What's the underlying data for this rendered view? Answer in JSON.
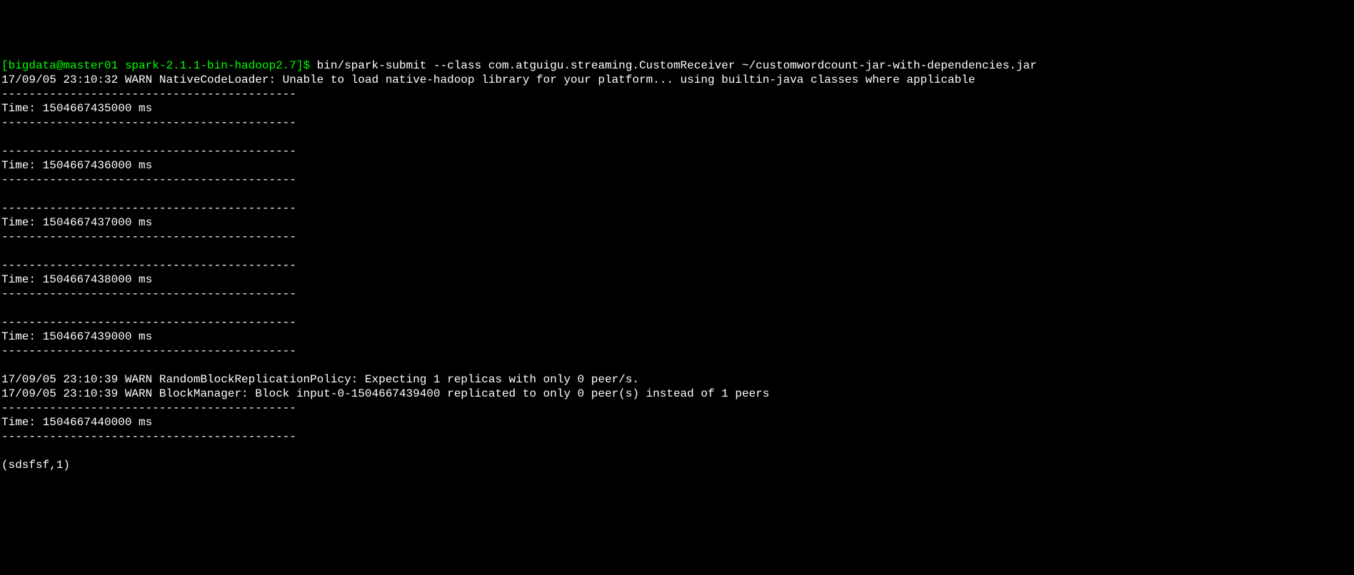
{
  "terminal": {
    "prompt": "[bigdata@master01 spark-2.1.1-bin-hadoop2.7]$ ",
    "command": "bin/spark-submit --class com.atguigu.streaming.CustomReceiver ~/customwordcount-jar-with-dependencies.jar",
    "warn1": "17/09/05 23:10:32 WARN NativeCodeLoader: Unable to load native-hadoop library for your platform... using builtin-java classes where applicable",
    "divider": "-------------------------------------------",
    "time1": "Time: 1504667435000 ms",
    "time2": "Time: 1504667436000 ms",
    "time3": "Time: 1504667437000 ms",
    "time4": "Time: 1504667438000 ms",
    "time5": "Time: 1504667439000 ms",
    "warn2": "17/09/05 23:10:39 WARN RandomBlockReplicationPolicy: Expecting 1 replicas with only 0 peer/s.",
    "warn3": "17/09/05 23:10:39 WARN BlockManager: Block input-0-1504667439400 replicated to only 0 peer(s) instead of 1 peers",
    "time6": "Time: 1504667440000 ms",
    "result": "(sdsfsf,1)"
  }
}
